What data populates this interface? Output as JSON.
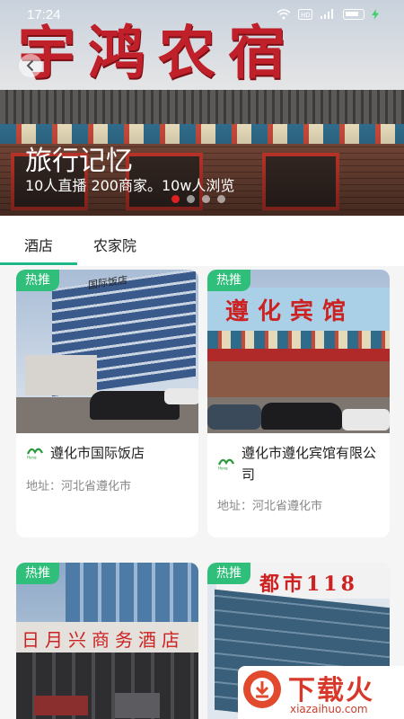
{
  "status_bar": {
    "time": "17:24"
  },
  "hero": {
    "sign_text": "宇鸿农宿",
    "title": "旅行记忆",
    "subtitle": "10人直播 200商家。10w人浏览",
    "back_icon": "chevron-left-icon",
    "carousel_dots": 4,
    "active_dot": 0
  },
  "tabs": [
    {
      "label": "酒店",
      "active": true
    },
    {
      "label": "农家院",
      "active": false
    }
  ],
  "cards": [
    {
      "badge": "热推",
      "name": "遵化市国际饭店",
      "address": "地址：河北省遵化市",
      "image_sign": "国际饭店"
    },
    {
      "badge": "热推",
      "name": "遵化市遵化宾馆有限公司",
      "address": "地址：河北省遵化市",
      "image_sign": "遵化宾馆"
    },
    {
      "badge": "热推",
      "image_sign": "日月兴商务酒店"
    },
    {
      "badge": "热推",
      "image_sign": "都市118"
    }
  ],
  "watermark": {
    "text": "下载火",
    "url": "xiazaihuo.com"
  },
  "colors": {
    "accent": "#21b889",
    "badge": "#2fbf7a",
    "active_dot": "#e02020"
  }
}
